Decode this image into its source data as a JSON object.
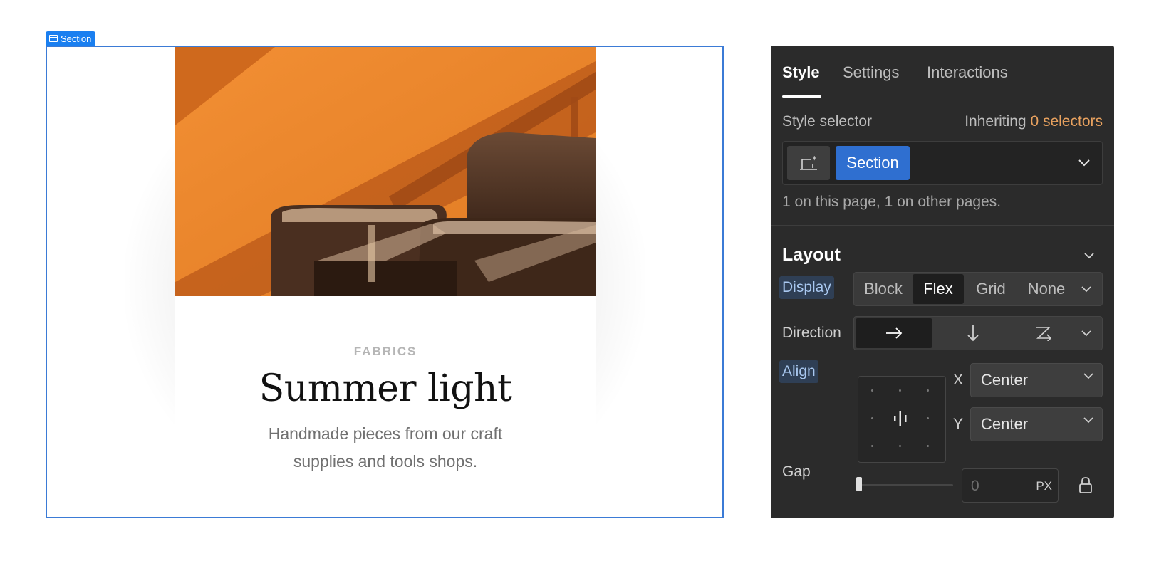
{
  "canvas": {
    "section_tag": "Section",
    "card": {
      "eyebrow": "FABRICS",
      "title": "Summer light",
      "description": "Handmade pieces from our craft supplies and tools shops."
    }
  },
  "panel": {
    "tabs": [
      {
        "label": "Style"
      },
      {
        "label": "Settings"
      },
      {
        "label": "Interactions"
      }
    ],
    "style_selector": {
      "label": "Style selector",
      "inheriting_prefix": "Inheriting",
      "inheriting_count": "0 selectors",
      "chip": "Section",
      "usage": "1 on this page, 1 on other pages."
    },
    "layout": {
      "title": "Layout",
      "display": {
        "label": "Display",
        "options": [
          "Block",
          "Flex",
          "Grid",
          "None"
        ],
        "selected": "Flex"
      },
      "direction": {
        "label": "Direction"
      },
      "align": {
        "label": "Align",
        "x_label": "X",
        "x_value": "Center",
        "y_label": "Y",
        "y_value": "Center"
      },
      "gap": {
        "label": "Gap",
        "value": "0",
        "unit": "PX"
      }
    }
  },
  "colors": {
    "selection_blue": "#3b7bd6",
    "chip_blue": "#2f6fd0",
    "panel_bg": "#2b2b2b",
    "accent_orange": "#e9a25f",
    "photo_orange": "#ef8a2e"
  }
}
